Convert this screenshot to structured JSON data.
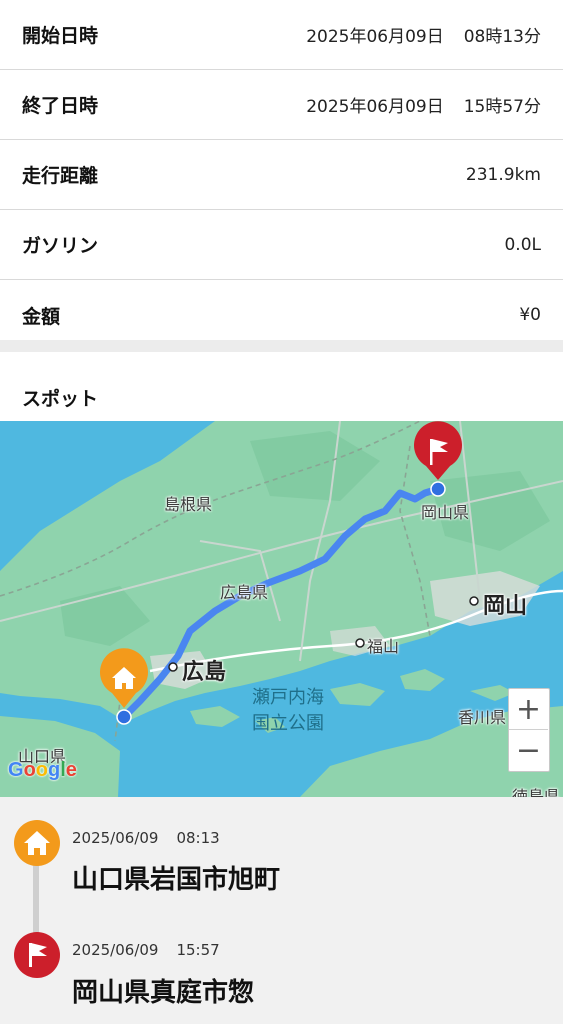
{
  "trip": {
    "start": {
      "label": "開始日時",
      "date": "2025年06月09日",
      "time": "08時13分"
    },
    "end": {
      "label": "終了日時",
      "date": "2025年06月09日",
      "time": "15時57分"
    },
    "distance": {
      "label": "走行距離",
      "value": "231.9km"
    },
    "gasoline": {
      "label": "ガソリン",
      "value": "0.0L"
    },
    "cost": {
      "label": "金額",
      "value": "¥0"
    }
  },
  "spots": {
    "title": "スポット",
    "map": {
      "labels": {
        "shimane": "島根県",
        "okayama_pref": "岡山県",
        "hiroshima_pref": "広島県",
        "okayama_city": "岡山",
        "fukuyama": "福山",
        "hiroshima_city": "広島",
        "setonaikai_1": "瀬戸内海",
        "setonaikai_2": "国立公園",
        "kagawa": "香川県",
        "yamaguchi": "山口県",
        "tokushima": "徳島県"
      },
      "attribution": "Google",
      "zoom_in": "+",
      "zoom_out": "−",
      "colors": {
        "route": "#4a86f0",
        "start_marker": "#f39a1b",
        "end_marker": "#cc1f2b",
        "sea": "#4fb8e0",
        "land": "#8fd3ad"
      }
    },
    "timeline": [
      {
        "icon": "home-icon",
        "date": "2025/06/09",
        "time": "08:13",
        "place": "山口県岩国市旭町"
      },
      {
        "icon": "flag-icon",
        "date": "2025/06/09",
        "time": "15:57",
        "place": "岡山県真庭市惣"
      }
    ]
  }
}
